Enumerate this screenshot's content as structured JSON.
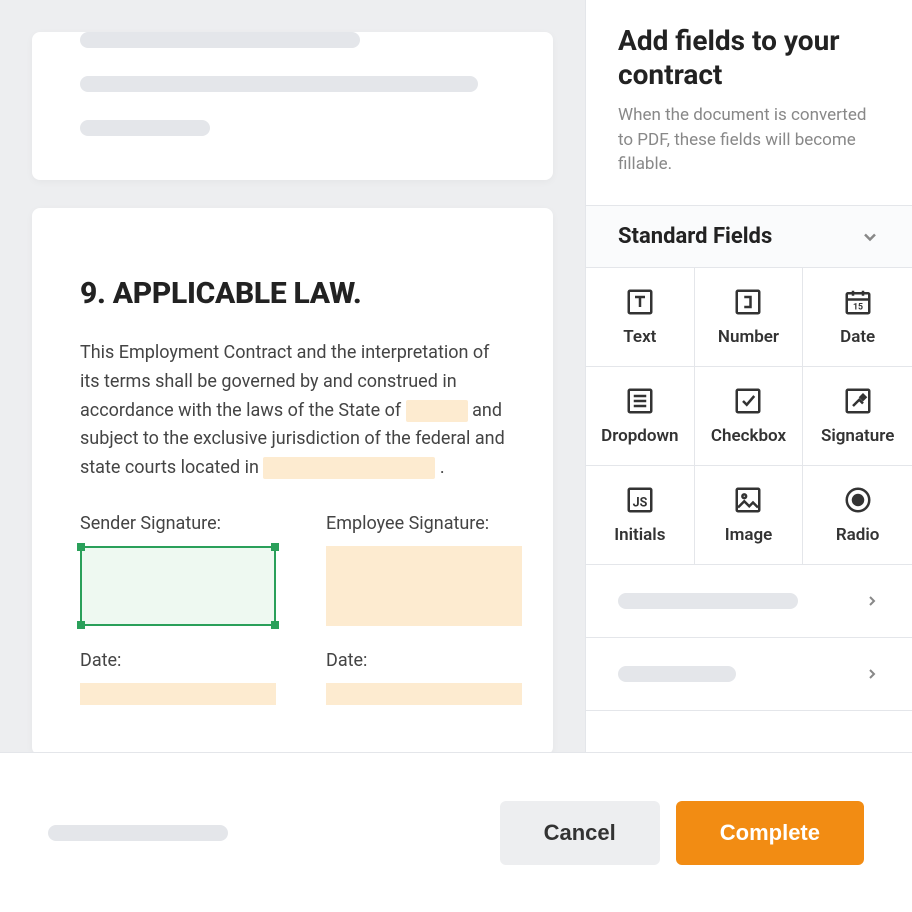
{
  "panel": {
    "title": "Add fields to your contract",
    "description": "When the document is converted to PDF, these fields will become fillable.",
    "section_title": "Standard Fields"
  },
  "fields": [
    {
      "label": "Text"
    },
    {
      "label": "Number"
    },
    {
      "label": "Date"
    },
    {
      "label": "Dropdown"
    },
    {
      "label": "Checkbox"
    },
    {
      "label": "Signature"
    },
    {
      "label": "Initials"
    },
    {
      "label": "Image"
    },
    {
      "label": "Radio"
    }
  ],
  "document": {
    "section_heading": "9. APPLICABLE LAW.",
    "body_before": "This Employment Contract and the interpretation of its terms shall be governed by and construed in accordance with the laws of the State of ",
    "body_mid": " and subject to the exclusive jurisdiction of the federal and state courts located in ",
    "body_after": " .",
    "sender_sig_label": "Sender Signature:",
    "employee_sig_label": "Employee Signature:",
    "date_label": "Date:"
  },
  "footer": {
    "cancel": "Cancel",
    "complete": "Complete"
  }
}
